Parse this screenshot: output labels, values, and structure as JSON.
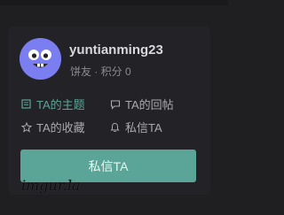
{
  "profile": {
    "username": "yuntianming23",
    "meta": "饼友 · 积分 0",
    "avatar_icon": "smiley-face-avatar"
  },
  "links": [
    {
      "label": "TA的主题",
      "icon": "list-icon",
      "active": true
    },
    {
      "label": "TA的回帖",
      "icon": "comment-icon",
      "active": false
    },
    {
      "label": "TA的收藏",
      "icon": "star-icon",
      "active": false
    },
    {
      "label": "私信TA",
      "icon": "bell-icon",
      "active": false
    }
  ],
  "button": {
    "label": "私信TA"
  },
  "watermark": "imgur.la",
  "colors": {
    "accent": "#5aa597",
    "avatar_bg": "#7b7ef0",
    "card_bg": "#232327",
    "page_bg": "#1f1f22"
  }
}
